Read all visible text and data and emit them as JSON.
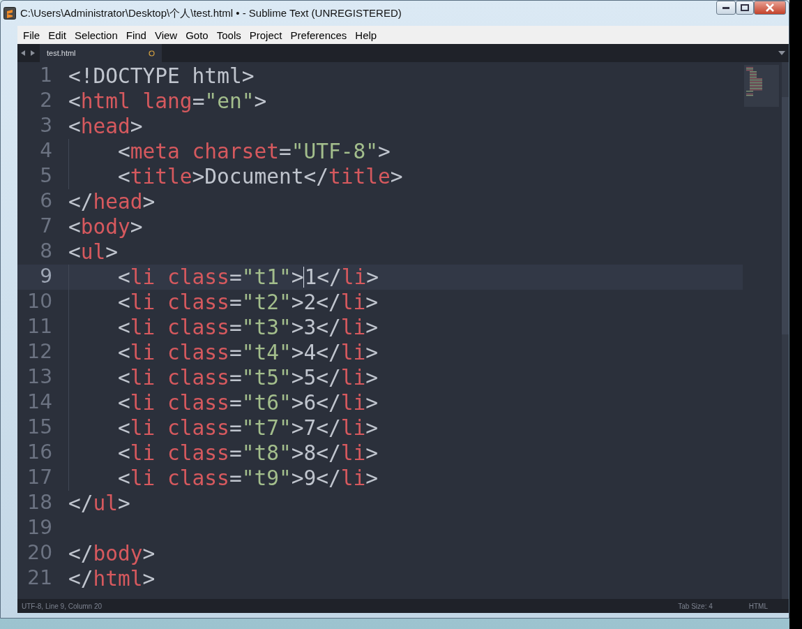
{
  "window": {
    "title": "C:\\Users\\Administrator\\Desktop\\个人\\test.html • - Sublime Text (UNREGISTERED)"
  },
  "menu": [
    "File",
    "Edit",
    "Selection",
    "Find",
    "View",
    "Goto",
    "Tools",
    "Project",
    "Preferences",
    "Help"
  ],
  "tabs": [
    {
      "label": "test.html",
      "selected": true,
      "modified": true
    }
  ],
  "lines": [
    {
      "number": "1",
      "selected": false,
      "indented": false,
      "tokens": [
        {
          "kind": "punct",
          "text": "<!DOCTYPE html>"
        }
      ]
    },
    {
      "number": "2",
      "selected": false,
      "indented": false,
      "tokens": [
        {
          "kind": "punct",
          "text": "<"
        },
        {
          "kind": "tag",
          "text": "html"
        },
        {
          "kind": "attr",
          "text": " lang"
        },
        {
          "kind": "punct",
          "text": "="
        },
        {
          "kind": "string",
          "text": "\"en\""
        },
        {
          "kind": "punct",
          "text": ">"
        }
      ]
    },
    {
      "number": "3",
      "selected": false,
      "indented": false,
      "tokens": [
        {
          "kind": "punct",
          "text": "<"
        },
        {
          "kind": "tag",
          "text": "head"
        },
        {
          "kind": "punct",
          "text": ">"
        }
      ]
    },
    {
      "number": "4",
      "selected": false,
      "indented": true,
      "tokens": [
        {
          "kind": "punct",
          "text": "<"
        },
        {
          "kind": "tag",
          "text": "meta"
        },
        {
          "kind": "attr",
          "text": " charset"
        },
        {
          "kind": "punct",
          "text": "="
        },
        {
          "kind": "string",
          "text": "\"UTF-8\""
        },
        {
          "kind": "punct",
          "text": ">"
        }
      ]
    },
    {
      "number": "5",
      "selected": false,
      "indented": true,
      "tokens": [
        {
          "kind": "punct",
          "text": "<"
        },
        {
          "kind": "tag",
          "text": "title"
        },
        {
          "kind": "punct",
          "text": ">"
        },
        {
          "kind": "text",
          "text": "Document"
        },
        {
          "kind": "punct",
          "text": "</"
        },
        {
          "kind": "tag",
          "text": "title"
        },
        {
          "kind": "punct",
          "text": ">"
        }
      ]
    },
    {
      "number": "6",
      "selected": false,
      "indented": false,
      "tokens": [
        {
          "kind": "punct",
          "text": "</"
        },
        {
          "kind": "tag",
          "text": "head"
        },
        {
          "kind": "punct",
          "text": ">"
        }
      ]
    },
    {
      "number": "7",
      "selected": false,
      "indented": false,
      "tokens": [
        {
          "kind": "punct",
          "text": "<"
        },
        {
          "kind": "tag",
          "text": "body"
        },
        {
          "kind": "punct",
          "text": ">"
        }
      ]
    },
    {
      "number": "8",
      "selected": false,
      "indented": false,
      "tokens": [
        {
          "kind": "punct",
          "text": "<"
        },
        {
          "kind": "tag",
          "text": "ul"
        },
        {
          "kind": "punct",
          "text": ">"
        }
      ]
    },
    {
      "number": "9",
      "selected": true,
      "indented": true,
      "tokens": [
        {
          "kind": "punct",
          "text": "<"
        },
        {
          "kind": "tag",
          "text": "li"
        },
        {
          "kind": "attr",
          "text": " class"
        },
        {
          "kind": "punct",
          "text": "="
        },
        {
          "kind": "string",
          "text": "\"t1\""
        },
        {
          "kind": "punct",
          "text": ">",
          "caret": true
        },
        {
          "kind": "text",
          "text": "1"
        },
        {
          "kind": "punct",
          "text": "</"
        },
        {
          "kind": "tag",
          "text": "li"
        },
        {
          "kind": "punct",
          "text": ">"
        }
      ]
    },
    {
      "number": "10",
      "selected": false,
      "indented": true,
      "tokens": [
        {
          "kind": "punct",
          "text": "<"
        },
        {
          "kind": "tag",
          "text": "li"
        },
        {
          "kind": "attr",
          "text": " class"
        },
        {
          "kind": "punct",
          "text": "="
        },
        {
          "kind": "string",
          "text": "\"t2\""
        },
        {
          "kind": "punct",
          "text": ">"
        },
        {
          "kind": "text",
          "text": "2"
        },
        {
          "kind": "punct",
          "text": "</"
        },
        {
          "kind": "tag",
          "text": "li"
        },
        {
          "kind": "punct",
          "text": ">"
        }
      ]
    },
    {
      "number": "11",
      "selected": false,
      "indented": true,
      "tokens": [
        {
          "kind": "punct",
          "text": "<"
        },
        {
          "kind": "tag",
          "text": "li"
        },
        {
          "kind": "attr",
          "text": " class"
        },
        {
          "kind": "punct",
          "text": "="
        },
        {
          "kind": "string",
          "text": "\"t3\""
        },
        {
          "kind": "punct",
          "text": ">"
        },
        {
          "kind": "text",
          "text": "3"
        },
        {
          "kind": "punct",
          "text": "</"
        },
        {
          "kind": "tag",
          "text": "li"
        },
        {
          "kind": "punct",
          "text": ">"
        }
      ]
    },
    {
      "number": "12",
      "selected": false,
      "indented": true,
      "tokens": [
        {
          "kind": "punct",
          "text": "<"
        },
        {
          "kind": "tag",
          "text": "li"
        },
        {
          "kind": "attr",
          "text": " class"
        },
        {
          "kind": "punct",
          "text": "="
        },
        {
          "kind": "string",
          "text": "\"t4\""
        },
        {
          "kind": "punct",
          "text": ">"
        },
        {
          "kind": "text",
          "text": "4"
        },
        {
          "kind": "punct",
          "text": "</"
        },
        {
          "kind": "tag",
          "text": "li"
        },
        {
          "kind": "punct",
          "text": ">"
        }
      ]
    },
    {
      "number": "13",
      "selected": false,
      "indented": true,
      "tokens": [
        {
          "kind": "punct",
          "text": "<"
        },
        {
          "kind": "tag",
          "text": "li"
        },
        {
          "kind": "attr",
          "text": " class"
        },
        {
          "kind": "punct",
          "text": "="
        },
        {
          "kind": "string",
          "text": "\"t5\""
        },
        {
          "kind": "punct",
          "text": ">"
        },
        {
          "kind": "text",
          "text": "5"
        },
        {
          "kind": "punct",
          "text": "</"
        },
        {
          "kind": "tag",
          "text": "li"
        },
        {
          "kind": "punct",
          "text": ">"
        }
      ]
    },
    {
      "number": "14",
      "selected": false,
      "indented": true,
      "tokens": [
        {
          "kind": "punct",
          "text": "<"
        },
        {
          "kind": "tag",
          "text": "li"
        },
        {
          "kind": "attr",
          "text": " class"
        },
        {
          "kind": "punct",
          "text": "="
        },
        {
          "kind": "string",
          "text": "\"t6\""
        },
        {
          "kind": "punct",
          "text": ">"
        },
        {
          "kind": "text",
          "text": "6"
        },
        {
          "kind": "punct",
          "text": "</"
        },
        {
          "kind": "tag",
          "text": "li"
        },
        {
          "kind": "punct",
          "text": ">"
        }
      ]
    },
    {
      "number": "15",
      "selected": false,
      "indented": true,
      "tokens": [
        {
          "kind": "punct",
          "text": "<"
        },
        {
          "kind": "tag",
          "text": "li"
        },
        {
          "kind": "attr",
          "text": " class"
        },
        {
          "kind": "punct",
          "text": "="
        },
        {
          "kind": "string",
          "text": "\"t7\""
        },
        {
          "kind": "punct",
          "text": ">"
        },
        {
          "kind": "text",
          "text": "7"
        },
        {
          "kind": "punct",
          "text": "</"
        },
        {
          "kind": "tag",
          "text": "li"
        },
        {
          "kind": "punct",
          "text": ">"
        }
      ]
    },
    {
      "number": "16",
      "selected": false,
      "indented": true,
      "tokens": [
        {
          "kind": "punct",
          "text": "<"
        },
        {
          "kind": "tag",
          "text": "li"
        },
        {
          "kind": "attr",
          "text": " class"
        },
        {
          "kind": "punct",
          "text": "="
        },
        {
          "kind": "string",
          "text": "\"t8\""
        },
        {
          "kind": "punct",
          "text": ">"
        },
        {
          "kind": "text",
          "text": "8"
        },
        {
          "kind": "punct",
          "text": "</"
        },
        {
          "kind": "tag",
          "text": "li"
        },
        {
          "kind": "punct",
          "text": ">"
        }
      ]
    },
    {
      "number": "17",
      "selected": false,
      "indented": true,
      "tokens": [
        {
          "kind": "punct",
          "text": "<"
        },
        {
          "kind": "tag",
          "text": "li"
        },
        {
          "kind": "attr",
          "text": " class"
        },
        {
          "kind": "punct",
          "text": "="
        },
        {
          "kind": "string",
          "text": "\"t9\""
        },
        {
          "kind": "punct",
          "text": ">"
        },
        {
          "kind": "text",
          "text": "9"
        },
        {
          "kind": "punct",
          "text": "</"
        },
        {
          "kind": "tag",
          "text": "li"
        },
        {
          "kind": "punct",
          "text": ">"
        }
      ]
    },
    {
      "number": "18",
      "selected": false,
      "indented": false,
      "tokens": [
        {
          "kind": "punct",
          "text": "</"
        },
        {
          "kind": "tag",
          "text": "ul"
        },
        {
          "kind": "punct",
          "text": ">"
        }
      ]
    },
    {
      "number": "19",
      "selected": false,
      "indented": false
    },
    {
      "number": "20",
      "selected": false,
      "indented": false,
      "tokens": [
        {
          "kind": "punct",
          "text": "</"
        },
        {
          "kind": "tag",
          "text": "body"
        },
        {
          "kind": "punct",
          "text": ">"
        }
      ]
    },
    {
      "number": "21",
      "selected": false,
      "indented": false,
      "tokens": [
        {
          "kind": "punct",
          "text": "</"
        },
        {
          "kind": "tag",
          "text": "html"
        },
        {
          "kind": "punct",
          "text": ">"
        }
      ]
    }
  ],
  "status_bar": {
    "position": "UTF-8, Line 9, Column 20",
    "tab_size": "Tab Size: 4",
    "syntax": "HTML"
  }
}
